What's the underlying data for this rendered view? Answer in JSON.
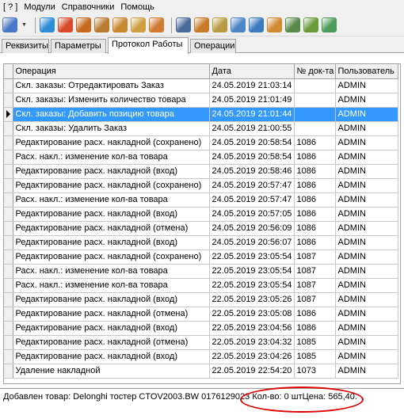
{
  "menu": [
    "[ ? ]",
    "Модули",
    "Справочники",
    "Помощь"
  ],
  "toolbar": {
    "buttons": [
      {
        "name": "grid-icon",
        "color": "#4a78c8"
      },
      {
        "name": "search-icon",
        "color": "#2e8bd6"
      },
      {
        "name": "book-icon",
        "color": "#d84a2a"
      },
      {
        "name": "user-edit-icon",
        "color": "#c86a1e"
      },
      {
        "name": "user-delete-icon",
        "color": "#b87a2e"
      },
      {
        "name": "user-key-icon",
        "color": "#c8862e"
      },
      {
        "name": "folder-arrow-icon",
        "color": "#d0a040"
      },
      {
        "name": "export-icon",
        "color": "#d07a30"
      },
      {
        "name": "calculator-icon",
        "color": "#4a6a9a"
      },
      {
        "name": "archive-box-icon",
        "color": "#c87a28"
      },
      {
        "name": "database-icon",
        "color": "#b89a40"
      },
      {
        "name": "monitor-icon",
        "color": "#4a86c8"
      },
      {
        "name": "network-icon",
        "color": "#3a7ac0"
      },
      {
        "name": "users-group-icon",
        "color": "#d08a30"
      },
      {
        "name": "building-icon",
        "color": "#5a8a4a"
      },
      {
        "name": "gears-icon",
        "color": "#6a9a3a"
      },
      {
        "name": "money-icon",
        "color": "#4a9a5a"
      }
    ]
  },
  "tabs": [
    "Реквизиты",
    "Параметры",
    "Протокол Работы",
    "Операции"
  ],
  "active_tab": 2,
  "grid": {
    "columns": [
      "Операция",
      "Дата",
      "№ док-та",
      "Пользователь"
    ],
    "selected_row": 2,
    "rows": [
      [
        "Скл. заказы: Отредактировать Заказ",
        "24.05.2019 21:03:14",
        "",
        "ADMIN"
      ],
      [
        "Скл. заказы: Изменить количество товара",
        "24.05.2019 21:01:49",
        "",
        "ADMIN"
      ],
      [
        "Скл. заказы: Добавить позицию товара",
        "24.05.2019 21:01:44",
        "",
        "ADMIN"
      ],
      [
        "Скл. заказы: Удалить Заказ",
        "24.05.2019 21:00:55",
        "",
        "ADMIN"
      ],
      [
        "Редактирование расх. накладной (сохранено)",
        "24.05.2019 20:58:54",
        "1086",
        "ADMIN"
      ],
      [
        "Расх. накл.: изменение кол-ва товара",
        "24.05.2019 20:58:54",
        "1086",
        "ADMIN"
      ],
      [
        "Редактирование расх. накладной (вход)",
        "24.05.2019 20:58:46",
        "1086",
        "ADMIN"
      ],
      [
        "Редактирование расх. накладной (сохранено)",
        "24.05.2019 20:57:47",
        "1086",
        "ADMIN"
      ],
      [
        "Расх. накл.: изменение кол-ва товара",
        "24.05.2019 20:57:47",
        "1086",
        "ADMIN"
      ],
      [
        "Редактирование расх. накладной (вход)",
        "24.05.2019 20:57:05",
        "1086",
        "ADMIN"
      ],
      [
        "Редактирование расх. накладной (отмена)",
        "24.05.2019 20:56:09",
        "1086",
        "ADMIN"
      ],
      [
        "Редактирование расх. накладной (вход)",
        "24.05.2019 20:56:07",
        "1086",
        "ADMIN"
      ],
      [
        "Редактирование расх. накладной (сохранено)",
        "22.05.2019 23:05:54",
        "1087",
        "ADMIN"
      ],
      [
        "Расх. накл.: изменение кол-ва товара",
        "22.05.2019 23:05:54",
        "1087",
        "ADMIN"
      ],
      [
        "Расх. накл.: изменение кол-ва товара",
        "22.05.2019 23:05:54",
        "1087",
        "ADMIN"
      ],
      [
        "Редактирование расх. накладной (вход)",
        "22.05.2019 23:05:26",
        "1087",
        "ADMIN"
      ],
      [
        "Редактирование расх. накладной (отмена)",
        "22.05.2019 23:05:08",
        "1086",
        "ADMIN"
      ],
      [
        "Редактирование расх. накладной (вход)",
        "22.05.2019 23:04:56",
        "1086",
        "ADMIN"
      ],
      [
        "Редактирование расх. накладной (отмена)",
        "22.05.2019 23:04:32",
        "1085",
        "ADMIN"
      ],
      [
        "Редактирование расх. накладной (вход)",
        "22.05.2019 23:04:26",
        "1085",
        "ADMIN"
      ],
      [
        "Удаление накладной",
        "22.05.2019 22:54:20",
        "1073",
        "ADMIN"
      ]
    ]
  },
  "status": {
    "text": "Добавлен товар: Delonghi тостер CTOV2003.BW 0176129023 Кол-во: 0 штЦена: 565,40."
  },
  "colors": {
    "selection": "#3399ff",
    "highlight_oval": "#e00000"
  }
}
